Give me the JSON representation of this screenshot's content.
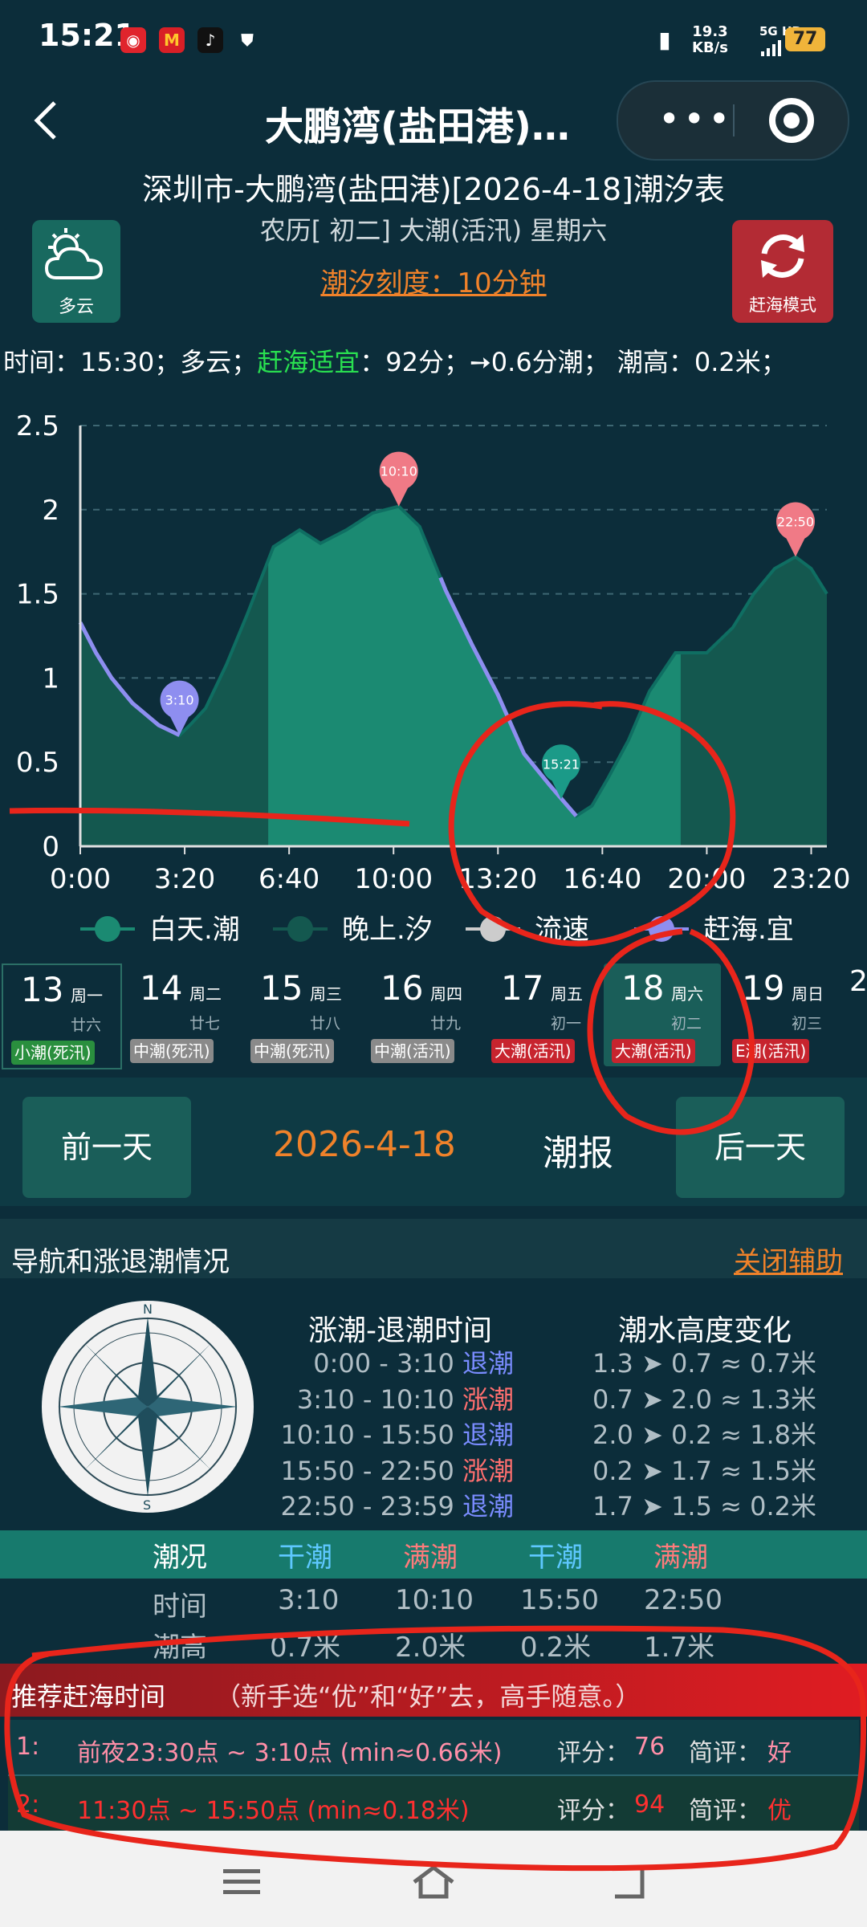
{
  "status_bar": {
    "time": "15:21",
    "net_speed_value": "19.3",
    "net_speed_unit": "KB/s",
    "net_type": "5G HD",
    "battery": "77"
  },
  "title_bar": {
    "back_icon": "chevron-left-icon",
    "title": "大鹏湾(盐田港)…",
    "more_icon": "more-dots-icon",
    "target_icon": "target-icon"
  },
  "header": {
    "heading": "深圳市-大鹏湾(盐田港)[2026-4-18]潮汐表",
    "subheading": "农历[ 初二] 大潮(活汛) 星期六",
    "scale_link": "潮汐刻度：10分钟",
    "weather_label": "多云",
    "mode_label": "赶海模式"
  },
  "info": {
    "prefix": "时间：15:30；多云；",
    "suitable": "赶海适宜",
    "suffix": "：92分；➙0.6分潮； 潮高：0.2米；"
  },
  "chart_data": {
    "type": "area",
    "y_ticks": [
      "2.5",
      "2",
      "1.5",
      "1",
      "0.5",
      "0"
    ],
    "x_ticks": [
      "0:00",
      "3:20",
      "6:40",
      "10:00",
      "13:20",
      "16:40",
      "20:00",
      "23:20"
    ],
    "ylim": [
      0,
      2.5
    ],
    "xlim_minutes": [
      0,
      1430
    ],
    "series": [
      {
        "name": "白天.潮",
        "color": "#1b8a72"
      },
      {
        "name": "晚上.汐",
        "color": "#14584f"
      },
      {
        "name": "流速",
        "color": "#cccccc"
      },
      {
        "name": "赶海.宜",
        "color": "#8e8ef0"
      }
    ],
    "points": [
      [
        0,
        1.33
      ],
      [
        30,
        1.15
      ],
      [
        60,
        1.0
      ],
      [
        100,
        0.85
      ],
      [
        150,
        0.72
      ],
      [
        190,
        0.66
      ],
      [
        210,
        0.72
      ],
      [
        240,
        0.82
      ],
      [
        280,
        1.08
      ],
      [
        320,
        1.38
      ],
      [
        370,
        1.78
      ],
      [
        420,
        1.88
      ],
      [
        460,
        1.8
      ],
      [
        510,
        1.88
      ],
      [
        560,
        1.98
      ],
      [
        610,
        2.02
      ],
      [
        650,
        1.9
      ],
      [
        700,
        1.52
      ],
      [
        750,
        1.2
      ],
      [
        800,
        0.9
      ],
      [
        850,
        0.55
      ],
      [
        900,
        0.36
      ],
      [
        950,
        0.18
      ],
      [
        980,
        0.24
      ],
      [
        1010,
        0.4
      ],
      [
        1050,
        0.63
      ],
      [
        1090,
        0.92
      ],
      [
        1140,
        1.15
      ],
      [
        1200,
        1.15
      ],
      [
        1250,
        1.3
      ],
      [
        1290,
        1.5
      ],
      [
        1330,
        1.65
      ],
      [
        1370,
        1.72
      ],
      [
        1400,
        1.65
      ],
      [
        1430,
        1.5
      ]
    ],
    "day_range_minutes": [
      360,
      1150
    ],
    "markers": [
      {
        "label": "3:10",
        "x": 190,
        "y": 0.66,
        "color": "#8e8ef0"
      },
      {
        "label": "10:10",
        "x": 610,
        "y": 2.02,
        "color": "#f07a86"
      },
      {
        "label": "15:21",
        "x": 921,
        "y": 0.28,
        "color": "#1b9a88"
      },
      {
        "label": "22:50",
        "x": 1370,
        "y": 1.72,
        "color": "#f07a86"
      }
    ],
    "highlight_ranges_minutes": [
      [
        0,
        190
      ],
      [
        690,
        950
      ]
    ]
  },
  "days": [
    {
      "num": "13",
      "weekday": "周一",
      "lunar": "廿六",
      "tag": "小潮(死汛)",
      "tag_color": "green"
    },
    {
      "num": "14",
      "weekday": "周二",
      "lunar": "廿七",
      "tag": "中潮(死汛)",
      "tag_color": "gray"
    },
    {
      "num": "15",
      "weekday": "周三",
      "lunar": "廿八",
      "tag": "中潮(死汛)",
      "tag_color": "gray"
    },
    {
      "num": "16",
      "weekday": "周四",
      "lunar": "廿九",
      "tag": "中潮(活汛)",
      "tag_color": "gray"
    },
    {
      "num": "17",
      "weekday": "周五",
      "lunar": "初一",
      "tag": "大潮(活汛)",
      "tag_color": "red"
    },
    {
      "num": "18",
      "weekday": "周六",
      "lunar": "初二",
      "tag": "大潮(活汛)",
      "tag_color": "red"
    },
    {
      "num": "19",
      "weekday": "周日",
      "lunar": "初三",
      "tag": "E潮(活汛)",
      "tag_color": "red"
    }
  ],
  "nav": {
    "prev": "前一天",
    "date": "2026-4-18",
    "report": "潮报",
    "next": "后一天"
  },
  "section": {
    "title": "导航和涨退潮情况",
    "close": "关闭辅助",
    "compass_icon": "compass-rose-icon",
    "tide_times_title": "涨潮-退潮时间",
    "tide_height_title": "潮水高度变化",
    "tide_times": [
      {
        "range": "0:00 - 3:10",
        "type": "退潮"
      },
      {
        "range": "3:10 - 10:10",
        "type": "涨潮"
      },
      {
        "range": "10:10 - 15:50",
        "type": "退潮"
      },
      {
        "range": "15:50 - 22:50",
        "type": "涨潮"
      },
      {
        "range": "22:50 - 23:59",
        "type": "退潮"
      }
    ],
    "tide_heights": [
      "1.3 ➤ 0.7 ≈ 0.7米",
      "0.7 ➤ 2.0 ≈ 1.3米",
      "2.0 ➤ 0.2 ≈ 1.8米",
      "0.2 ➤ 1.7 ≈ 1.5米",
      "1.7 ➤ 1.5 ≈ 0.2米"
    ]
  },
  "tide_table": {
    "headers": [
      "潮况",
      "干潮",
      "满潮",
      "干潮",
      "满潮"
    ],
    "time_label": "时间",
    "times": [
      "3:10",
      "10:10",
      "15:50",
      "22:50"
    ],
    "height_label": "潮高",
    "heights": [
      "0.7米",
      "2.0米",
      "0.2米",
      "1.7米"
    ]
  },
  "recommend": {
    "title": "推荐赶海时间",
    "note": "（新手选“优”和“好”去，高手随意。）",
    "rows": [
      {
        "idx": "1:",
        "time": "前夜23:30点 ~ 3:10点 (min≈0.66米)",
        "score_label": "评分：",
        "score": "76",
        "eval_label": "简评：",
        "eval": "好"
      },
      {
        "idx": "2:",
        "time": "11:30点 ~ 15:50点 (min≈0.18米)",
        "score_label": "评分：",
        "score": "94",
        "eval_label": "简评：",
        "eval": "优"
      }
    ]
  },
  "annotations": {
    "color": "#e8251b"
  },
  "system_nav": {
    "menu_icon": "menu-lines-icon",
    "home_icon": "home-icon",
    "back_icon": "back-icon"
  }
}
